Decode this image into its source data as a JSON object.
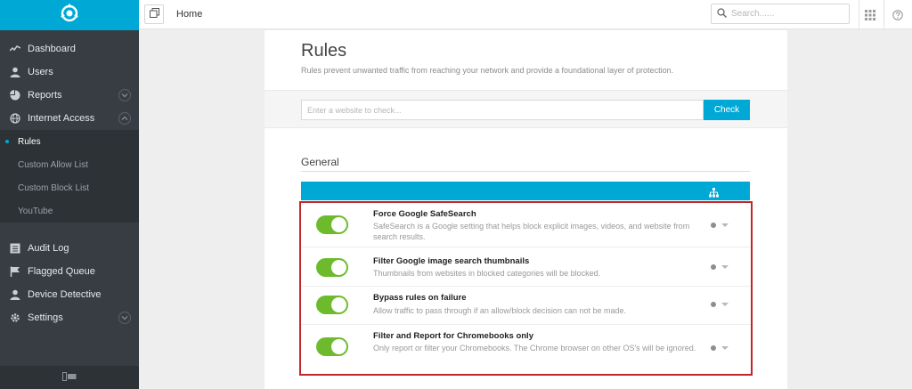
{
  "sidebar": {
    "items": [
      {
        "label": "Dashboard",
        "icon": "activity-icon"
      },
      {
        "label": "Users",
        "icon": "user-icon"
      },
      {
        "label": "Reports",
        "icon": "pie-chart-icon"
      },
      {
        "label": "Internet Access",
        "icon": "globe-icon"
      }
    ],
    "subitems": [
      {
        "label": "Rules",
        "active": true
      },
      {
        "label": "Custom Allow List"
      },
      {
        "label": "Custom Block List"
      },
      {
        "label": "YouTube"
      }
    ],
    "items2": [
      {
        "label": "Audit Log",
        "icon": "list-icon"
      },
      {
        "label": "Flagged Queue",
        "icon": "flag-icon"
      },
      {
        "label": "Device Detective",
        "icon": "user-icon"
      },
      {
        "label": "Settings",
        "icon": "gear-icon"
      }
    ]
  },
  "topbar": {
    "breadcrumb": "Home",
    "search_placeholder": "Search......"
  },
  "page": {
    "title": "Rules",
    "subtitle": "Rules prevent unwanted traffic from reaching your network and provide a foundational layer of protection.",
    "check_placeholder": "Enter a website to check...",
    "check_button": "Check",
    "section_title": "General"
  },
  "rules": [
    {
      "name": "Force Google SafeSearch",
      "description": "SafeSearch is a Google setting that helps block explicit images, videos, and website from search results.",
      "enabled": true
    },
    {
      "name": "Filter Google image search thumbnails",
      "description": "Thumbnails from websites in blocked categories will be blocked.",
      "enabled": true
    },
    {
      "name": "Bypass rules on failure",
      "description": "Allow traffic to pass through if an allow/block decision can not be made.",
      "enabled": true
    },
    {
      "name": "Filter and Report for Chromebooks only",
      "description": "Only report or filter your Chromebooks. The Chrome browser on other OS's will be ignored.",
      "enabled": true
    }
  ],
  "colors": {
    "accent": "#00a8d6",
    "sidebar_bg": "#373d43",
    "toggle_on": "#6dbb2d",
    "highlight_border": "#c0272d"
  }
}
